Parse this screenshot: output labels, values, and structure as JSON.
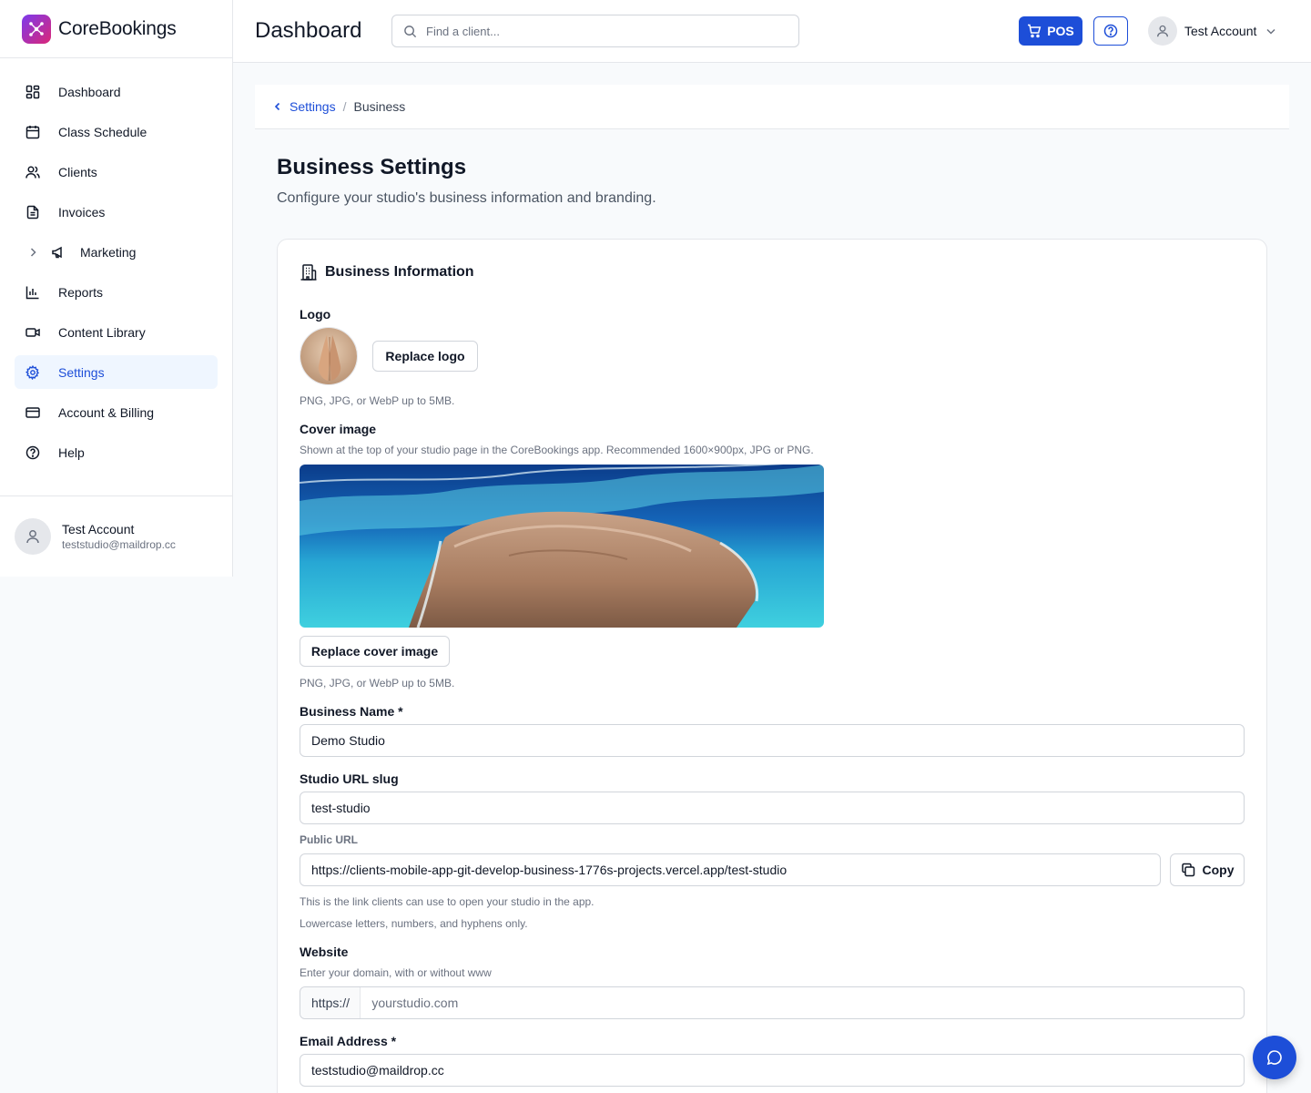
{
  "brand": {
    "name": "CoreBookings"
  },
  "header": {
    "title": "Dashboard",
    "search_placeholder": "Find a client...",
    "pos_label": "POS",
    "account_name": "Test Account"
  },
  "sidebar": {
    "items": [
      {
        "label": "Dashboard",
        "icon": "dashboard-icon"
      },
      {
        "label": "Class Schedule",
        "icon": "calendar-icon"
      },
      {
        "label": "Clients",
        "icon": "users-icon"
      },
      {
        "label": "Invoices",
        "icon": "file-text-icon"
      },
      {
        "label": "Marketing",
        "icon": "megaphone-icon"
      },
      {
        "label": "Reports",
        "icon": "bar-chart-icon"
      },
      {
        "label": "Content Library",
        "icon": "video-icon"
      },
      {
        "label": "Settings",
        "icon": "gear-icon",
        "active": true
      },
      {
        "label": "Account & Billing",
        "icon": "credit-card-icon"
      },
      {
        "label": "Help",
        "icon": "help-circle-icon"
      }
    ],
    "user": {
      "name": "Test Account",
      "email": "teststudio@maildrop.cc"
    }
  },
  "breadcrumb": {
    "parent": "Settings",
    "separator": "/",
    "current": "Business"
  },
  "page": {
    "title": "Business Settings",
    "subtitle": "Configure your studio's business information and branding."
  },
  "card": {
    "title": "Business Information",
    "logo": {
      "label": "Logo",
      "button": "Replace logo",
      "hint": "PNG, JPG, or WebP up to 5MB."
    },
    "cover": {
      "label": "Cover image",
      "description": "Shown at the top of your studio page in the CoreBookings app. Recommended 1600×900px, JPG or PNG.",
      "button": "Replace cover image",
      "hint": "PNG, JPG, or WebP up to 5MB."
    },
    "business_name": {
      "label": "Business Name *",
      "value": "Demo Studio"
    },
    "slug": {
      "label": "Studio URL slug",
      "value": "test-studio",
      "public_url_label": "Public URL",
      "public_url": "https://clients-mobile-app-git-develop-business-1776s-projects.vercel.app/test-studio",
      "copy_label": "Copy",
      "hint1": "This is the link clients can use to open your studio in the app.",
      "hint2": "Lowercase letters, numbers, and hyphens only."
    },
    "website": {
      "label": "Website",
      "hint": "Enter your domain, with or without www",
      "prefix": "https://",
      "placeholder": "yourstudio.com"
    },
    "email": {
      "label": "Email Address *",
      "value": "teststudio@maildrop.cc"
    }
  },
  "colors": {
    "accent": "#1d4ed8",
    "active_bg": "#eff6ff",
    "border": "#e5e7eb"
  }
}
